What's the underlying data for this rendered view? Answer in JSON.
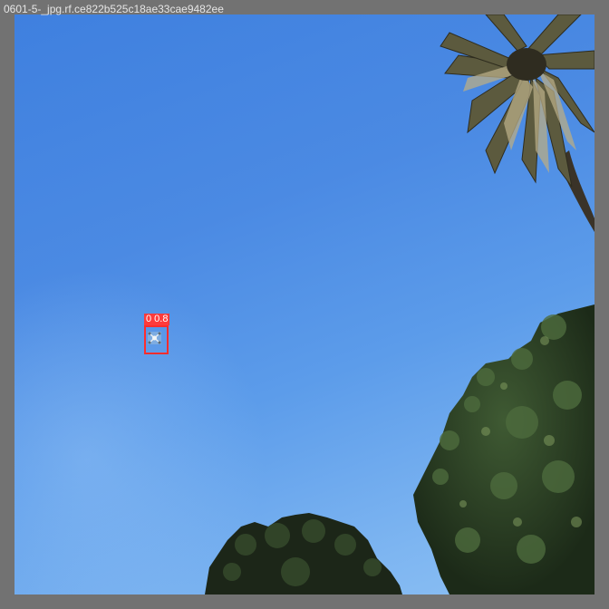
{
  "image_title": "0601-5-_jpg.rf.ce822b525c18ae33cae9482ee",
  "detection": {
    "label": "0 0.8"
  },
  "colors": {
    "frame": "#727272",
    "box": "#ff2d2d",
    "sky_top": "#3f80df",
    "sky_bottom": "#8ec1f4"
  }
}
